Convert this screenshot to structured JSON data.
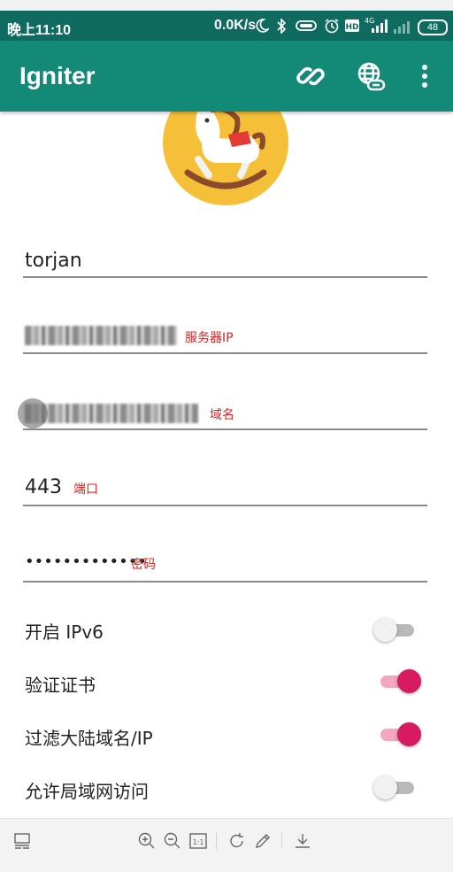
{
  "status_bar": {
    "time": "晚上11:10",
    "network_speed": "0.0K/s",
    "battery": "48",
    "icons": [
      "moon-icon",
      "bluetooth-icon",
      "vpn-key-icon",
      "alarm-icon",
      "hd-icon",
      "signal-4g-icon",
      "signal-icon",
      "battery-icon"
    ]
  },
  "app_bar": {
    "title": "Igniter",
    "actions": [
      "link-icon",
      "globe-link-icon",
      "more-vert-icon"
    ]
  },
  "form": {
    "password": {
      "value": "•••••••••••••",
      "hint": "密码"
    },
    "server_ip": {
      "hint": "服务器IP"
    },
    "domain": {
      "hint": "域名"
    },
    "port": {
      "value": "443",
      "hint": "端口"
    },
    "username": {
      "value": "torjan"
    }
  },
  "toggles": [
    {
      "label": "开启 IPv6",
      "state": "off"
    },
    {
      "label": "验证证书",
      "state": "on"
    },
    {
      "label": "过滤大陆域名/IP",
      "state": "on"
    },
    {
      "label": "允许局域网访问",
      "state": "off"
    }
  ],
  "colors": {
    "app_bar": "#138a78",
    "status_bar": "#0f6b5f",
    "accent": "#d81b60",
    "hint": "#e0201f",
    "logo_bg": "#f6bf38"
  },
  "bottom_toolbar": {
    "icons": [
      "layout-icon",
      "zoom-in-icon",
      "zoom-out-icon",
      "actual-size-icon",
      "rotate-icon",
      "edit-icon",
      "download-icon"
    ]
  }
}
